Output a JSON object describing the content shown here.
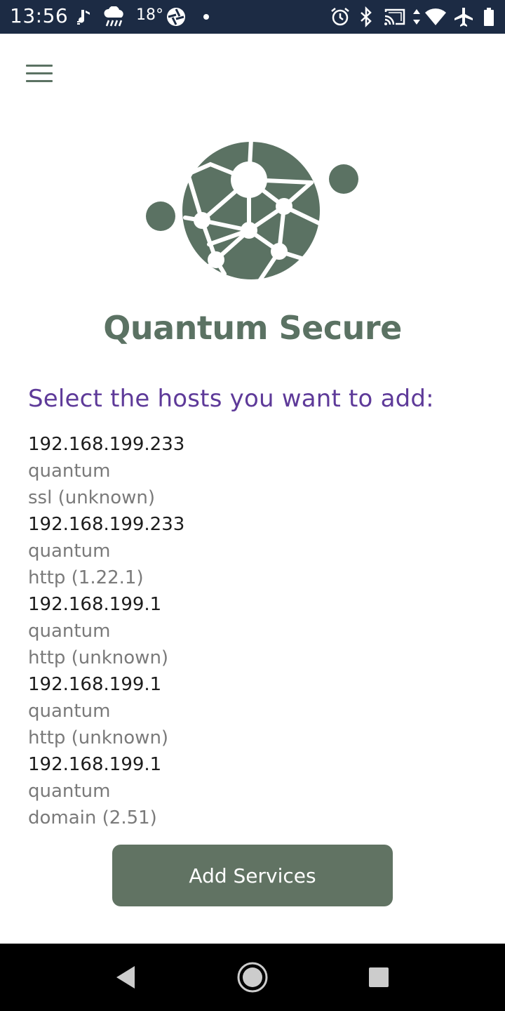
{
  "status_bar": {
    "time": "13:56",
    "temperature": "18°",
    "left_icons": [
      "music-note-icon",
      "rain-icon",
      "aperture-icon",
      "dot-icon"
    ],
    "right_icons": [
      "alarm-icon",
      "bluetooth-icon",
      "cast-icon",
      "data-arrows-icon",
      "wifi-icon",
      "airplane-icon",
      "battery-icon"
    ]
  },
  "app": {
    "title": "Quantum Secure",
    "menu_icon": "hamburger-menu-icon",
    "logo_icon": "network-globe-logo",
    "section_title": "Select the hosts you want to add:",
    "hosts": [
      {
        "ip": "192.168.199.233",
        "name": "quantum",
        "service": "ssl (unknown)"
      },
      {
        "ip": "192.168.199.233",
        "name": "quantum",
        "service": "http (1.22.1)"
      },
      {
        "ip": "192.168.199.1",
        "name": "quantum",
        "service": "http (unknown)"
      },
      {
        "ip": "192.168.199.1",
        "name": "quantum",
        "service": "http (unknown)"
      },
      {
        "ip": "192.168.199.1",
        "name": "quantum",
        "service": "domain (2.51)"
      }
    ],
    "add_button_label": "Add Services"
  },
  "nav_bar": {
    "buttons": [
      "back-icon",
      "home-icon",
      "recents-icon"
    ]
  },
  "colors": {
    "status_bar_bg": "#1c2b44",
    "brand_green": "#5b7263",
    "button_green": "#617363",
    "section_purple": "#5e3a99",
    "host_ip_text": "#1c1c1c",
    "host_meta_text": "#7a7a7a"
  }
}
